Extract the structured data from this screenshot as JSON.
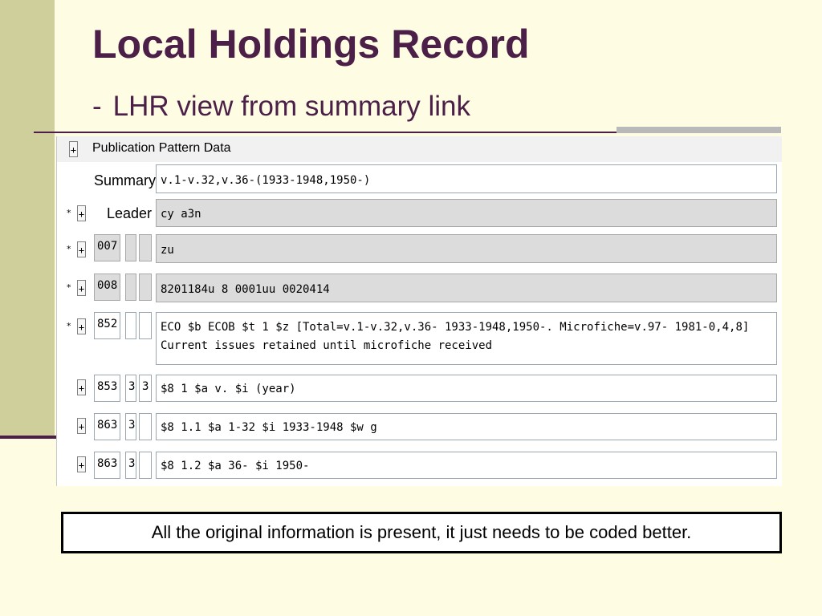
{
  "slide": {
    "title": "Local Holdings Record",
    "subtitle_dash": "-",
    "subtitle": "LHR view from summary link",
    "caption": "All the original information is present, it just needs to be coded better."
  },
  "panel": {
    "toggle_symbol": "+",
    "section_title": "Publication Pattern Data",
    "summary": {
      "label": "Summary",
      "value": "v.1-v.32,v.36-(1933-1948,1950-)"
    },
    "leader": {
      "star": "*",
      "label": "Leader",
      "value": "cy  a3n"
    },
    "rows": [
      {
        "star": "*",
        "tag": "007",
        "ind1": "",
        "ind2": "",
        "value": "zu"
      },
      {
        "star": "*",
        "tag": "008",
        "ind1": "",
        "ind2": "",
        "value": "8201184u    8   0001uu   0020414"
      },
      {
        "star": "*",
        "tag": "852",
        "ind1": "",
        "ind2": "",
        "value": "ECO $b ECOB $t 1 $z [Total=v.1-v.32,v.36- 1933-1948,1950-. Microfiche=v.97- 1981-0,4,8] Current issues retained until microfiche received"
      },
      {
        "star": "",
        "tag": "853",
        "ind1": "3",
        "ind2": "3",
        "value": "$8 1 $a v. $i (year)"
      },
      {
        "star": "",
        "tag": "863",
        "ind1": "3",
        "ind2": "",
        "value": "$8 1.1 $a 1-32 $i 1933-1948 $w g"
      },
      {
        "star": "",
        "tag": "863",
        "ind1": "3",
        "ind2": "",
        "value": "$8 1.2 $a 36- $i 1950-"
      }
    ]
  }
}
